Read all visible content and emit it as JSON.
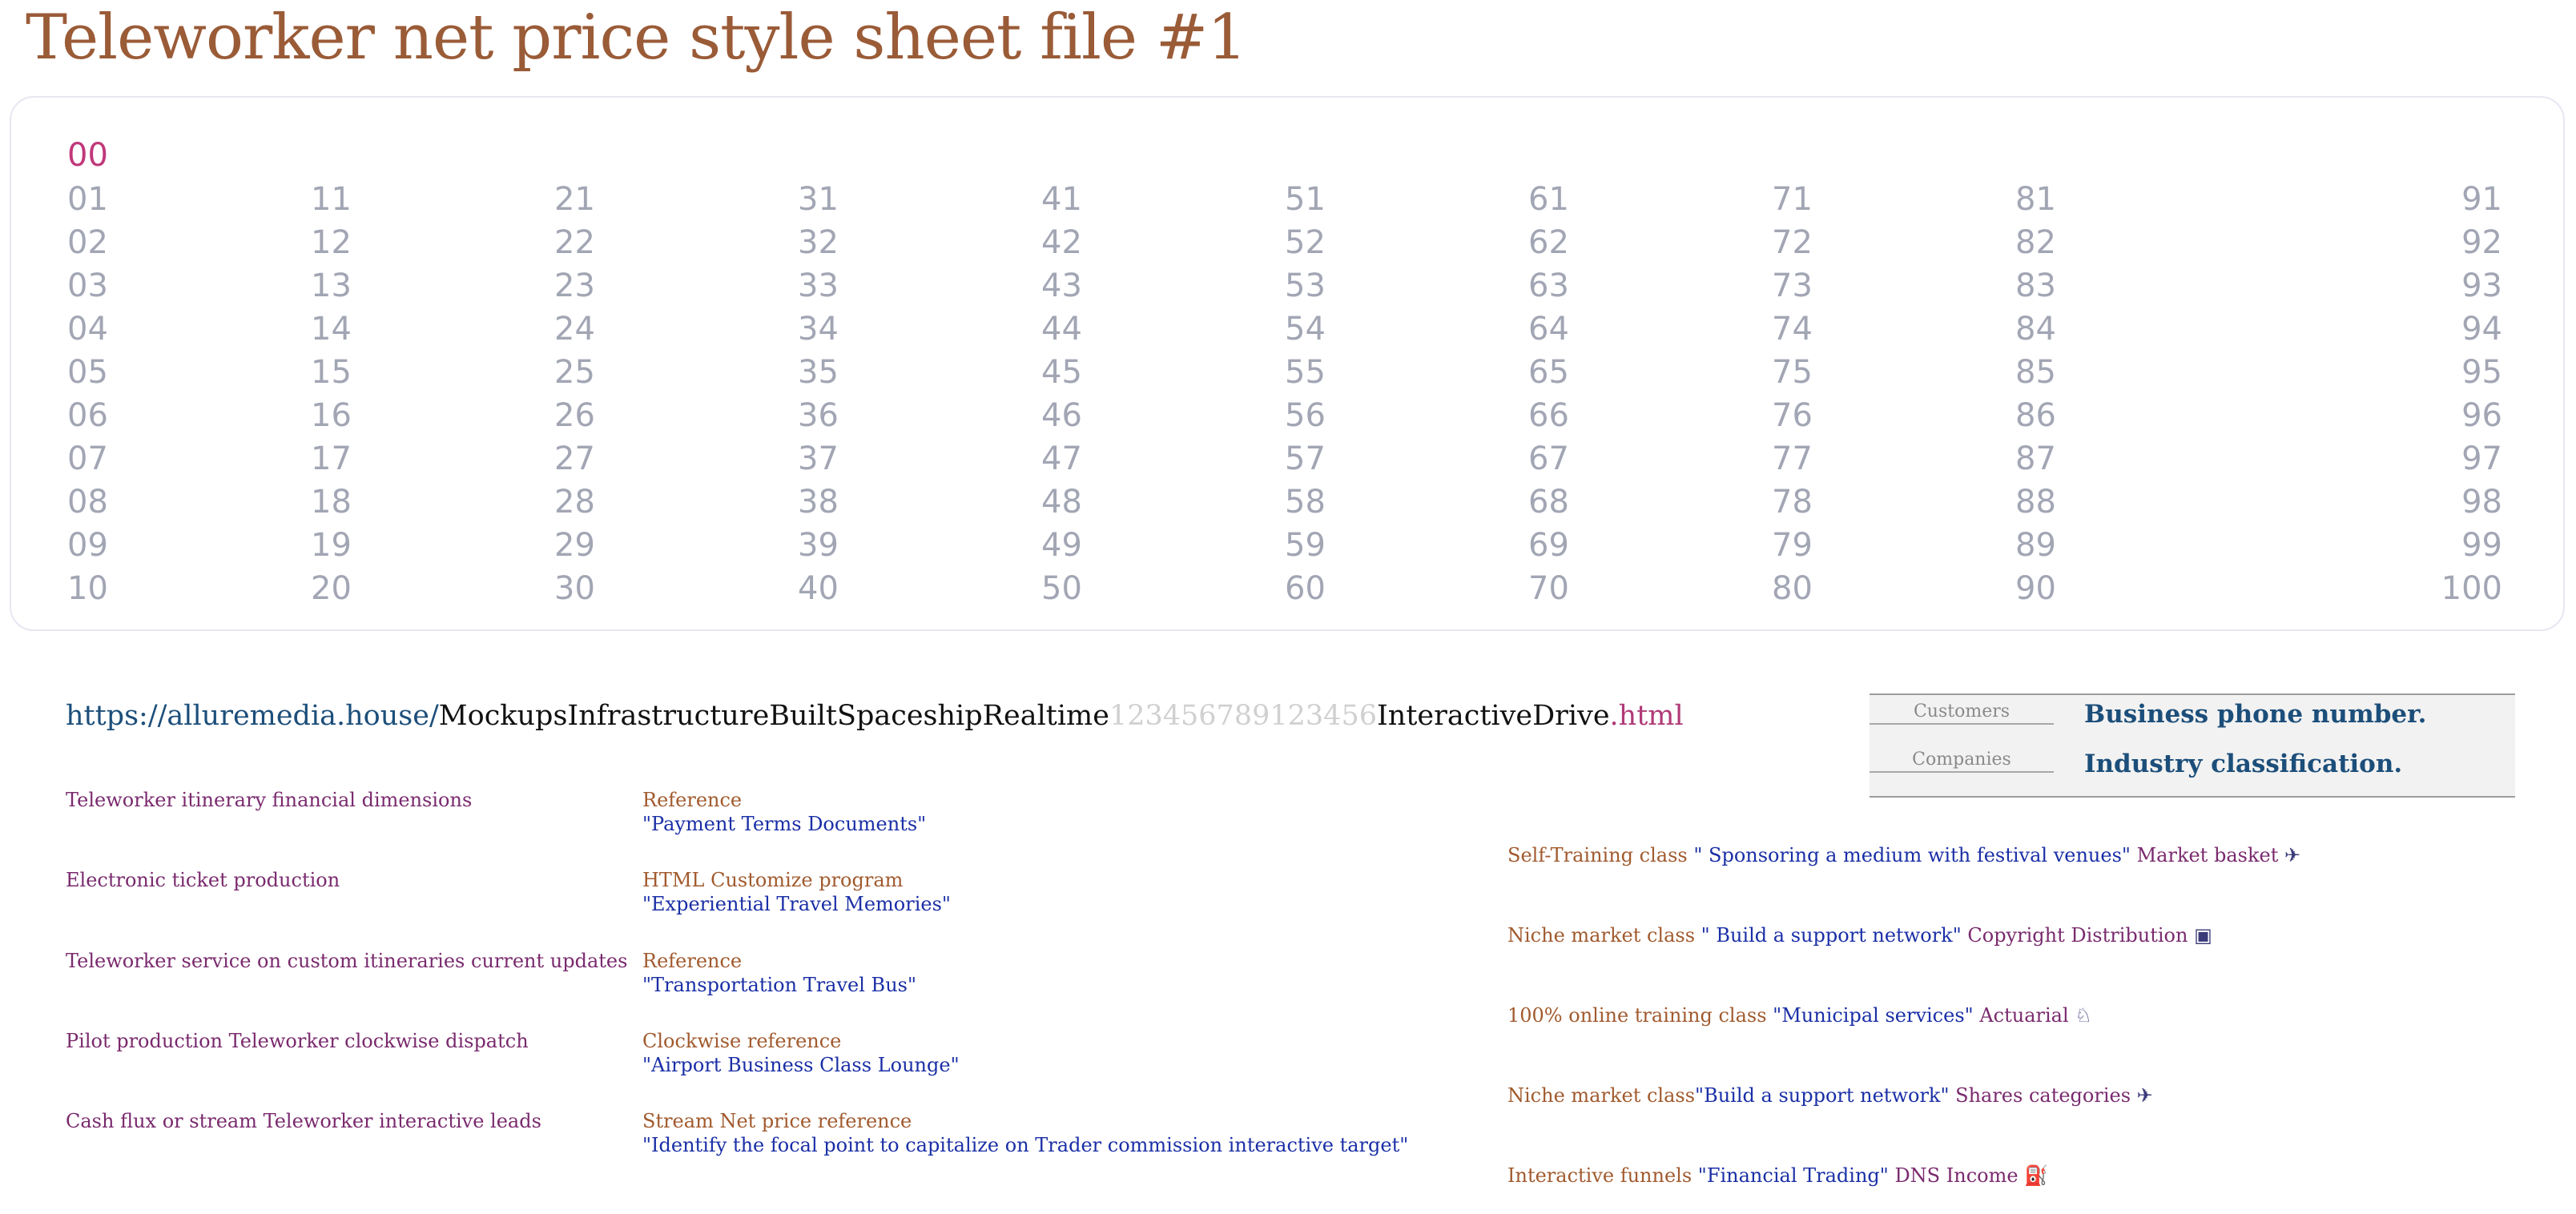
{
  "title": "Teleworker net price style sheet file #1",
  "numbers": {
    "header": "00",
    "columns": [
      [
        "01",
        "02",
        "03",
        "04",
        "05",
        "06",
        "07",
        "08",
        "09",
        "10"
      ],
      [
        "11",
        "12",
        "13",
        "14",
        "15",
        "16",
        "17",
        "18",
        "19",
        "20"
      ],
      [
        "21",
        "22",
        "23",
        "24",
        "25",
        "26",
        "27",
        "28",
        "29",
        "30"
      ],
      [
        "31",
        "32",
        "33",
        "34",
        "35",
        "36",
        "37",
        "38",
        "39",
        "40"
      ],
      [
        "41",
        "42",
        "43",
        "44",
        "45",
        "46",
        "47",
        "48",
        "49",
        "50"
      ],
      [
        "51",
        "52",
        "53",
        "54",
        "55",
        "56",
        "57",
        "58",
        "59",
        "60"
      ],
      [
        "61",
        "62",
        "63",
        "64",
        "65",
        "66",
        "67",
        "68",
        "69",
        "70"
      ],
      [
        "71",
        "72",
        "73",
        "74",
        "75",
        "76",
        "77",
        "78",
        "79",
        "80"
      ],
      [
        "81",
        "82",
        "83",
        "84",
        "85",
        "86",
        "87",
        "88",
        "89",
        "90"
      ],
      [
        "91",
        "92",
        "93",
        "94",
        "95",
        "96",
        "97",
        "98",
        "99",
        "100"
      ]
    ]
  },
  "url": {
    "scheme_host": "https://alluremedia.house/",
    "path": "MockupsInfrastructureBuiltSpaceshipRealtime",
    "digits": "123456789123456",
    "tail": "InteractiveDrive",
    "ext": ".html"
  },
  "info_box": {
    "rows": [
      {
        "label": "Customers",
        "value": "Business phone number."
      },
      {
        "label": "Companies",
        "value": "Industry classification."
      }
    ]
  },
  "items": [
    {
      "label": "Teleworker itinerary financial dimensions",
      "ref_type": "Reference",
      "ref_quote": "\"Payment Terms Documents\""
    },
    {
      "label": "Electronic ticket production",
      "ref_type": "HTML Customize program",
      "ref_quote": "\"Experiential Travel Memories\""
    },
    {
      "label": "Teleworker service on custom itineraries current updates",
      "ref_type": "Reference",
      "ref_quote": "\"Transportation Travel Bus\""
    },
    {
      "label": "Pilot production Teleworker clockwise dispatch",
      "ref_type": "Clockwise reference",
      "ref_quote": "\"Airport Business Class Lounge\""
    },
    {
      "label": "Cash flux or stream Teleworker interactive leads",
      "ref_type": "Stream Net price reference",
      "ref_quote": "\"Identify the focal point to capitalize on Trader commission interactive target\""
    }
  ],
  "classes": [
    {
      "class": "Self-Training class",
      "quote": " \" Sponsoring a medium with festival venues\"",
      "category": " Market basket ",
      "icon": "✈",
      "icon_name": "airplane-icon"
    },
    {
      "class": "Niche market  class",
      "quote": " \" Build a support network\"",
      "category": " Copyright Distribution ",
      "icon": "▣",
      "icon_name": "computer-icon"
    },
    {
      "class": "100% online training class",
      "quote": " \"Municipal services\"",
      "category": " Actuarial ",
      "icon": "♘",
      "icon_name": "person-at-desk-icon"
    },
    {
      "class": "Niche market class",
      "quote": "\"Build a support network\"",
      "category": " Shares categories ",
      "icon": "✈",
      "icon_name": "plane-departure-icon"
    },
    {
      "class": "Interactive funnels",
      "quote": " \"Financial Trading\"",
      "category": " DNS Income ",
      "icon": "⛽",
      "icon_name": "fuel-pump-icon"
    }
  ]
}
